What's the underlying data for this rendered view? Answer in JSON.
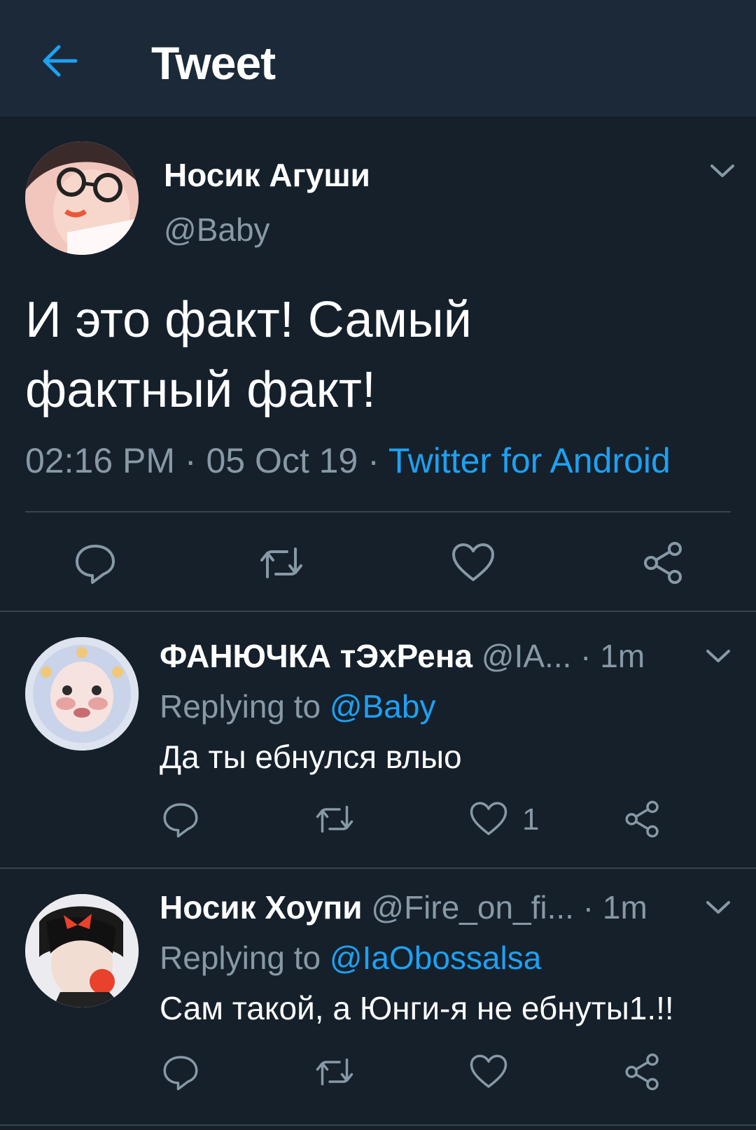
{
  "header": {
    "title": "Tweet",
    "back_icon": "arrow-left-icon",
    "accent": "#1da1f2"
  },
  "main_tweet": {
    "author_name": "Носик Агуши",
    "author_handle": "@Baby",
    "text_line1": "И это факт! Самый",
    "text_line2": "фактный факт!",
    "time": "02:16 PM",
    "sep1": "·",
    "date": "05 Oct 19",
    "sep2": "·",
    "source": "Twitter for Android"
  },
  "replies": [
    {
      "author_name": "ФАНЮЧКА тЭхРена",
      "author_handle": "@IA...",
      "dot": "·",
      "time": "1m",
      "replying_prefix": "Replying to",
      "replying_to": "@Baby",
      "text": "Да ты ебнулся влыо",
      "like_count": "1"
    },
    {
      "author_name": "Носик Хоупи",
      "author_handle": "@Fire_on_fi...",
      "dot": "·",
      "time": "1m",
      "replying_prefix": "Replying to",
      "replying_to": "@IaObossalsa",
      "text": "Сам такой, а Юнги-я не ебнуты1.!!",
      "like_count": ""
    }
  ],
  "colors": {
    "background": "#15202b",
    "header": "#1c2938",
    "secondary_text": "#8899a6",
    "link": "#1da1f2",
    "divider": "#38444d"
  }
}
